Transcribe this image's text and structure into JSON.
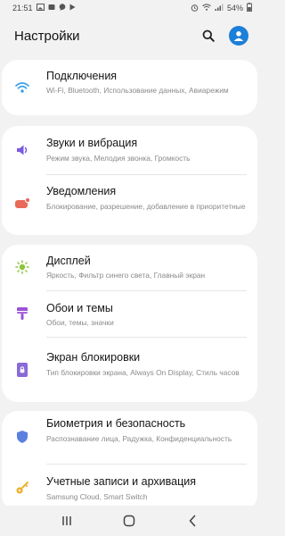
{
  "status_bar": {
    "time": "21:51",
    "battery": "54%",
    "left_icons": [
      "gallery-icon",
      "notification-icon",
      "chat-icon",
      "play-icon"
    ],
    "right_icons": [
      "alarm-icon",
      "wifi-icon",
      "signal-icon",
      "battery-icon"
    ]
  },
  "header": {
    "title": "Настройки",
    "search_icon": "search-icon",
    "profile_icon": "account-icon",
    "accent_color": "#1c7fd8"
  },
  "groups": [
    {
      "items": [
        {
          "title": "Подключения",
          "subtitle": "Wi-Fi, Bluetooth, Использование данных, Авиарежим",
          "icon": "wifi-icon",
          "color": "#3aa0e8"
        }
      ]
    },
    {
      "items": [
        {
          "title": "Звуки и вибрация",
          "subtitle": "Режим звука, Мелодия звонка, Громкость",
          "icon": "volume-icon",
          "color": "#7a5be0"
        },
        {
          "title": "Уведомления",
          "subtitle": "Блокирование, разрешение, добавление в приоритетные",
          "icon": "notification-badge-icon",
          "color": "#e86a5a"
        }
      ]
    },
    {
      "items": [
        {
          "title": "Дисплей",
          "subtitle": "Яркость, Фильтр синего света, Главный экран",
          "icon": "brightness-icon",
          "color": "#8cc43a"
        },
        {
          "title": "Обои и темы",
          "subtitle": "Обои, темы, значки",
          "icon": "brush-icon",
          "color": "#9a52d6"
        },
        {
          "title": "Экран блокировки",
          "subtitle": "Тип блокировки экрана, Always On Display, Стиль часов",
          "icon": "lock-screen-icon",
          "color": "#8a6ad6"
        }
      ]
    },
    {
      "items": [
        {
          "title": "Биометрия и безопасность",
          "subtitle": "Распознавание лица, Радужка, Конфиденциальность",
          "icon": "shield-icon",
          "color": "#5a7fe0"
        },
        {
          "title": "Учетные записи и архивация",
          "subtitle": "Samsung Cloud, Smart Switch",
          "icon": "key-icon",
          "color": "#f0b030"
        }
      ]
    }
  ],
  "nav_bar": {
    "icons": [
      "recent-apps-icon",
      "home-icon",
      "back-icon"
    ]
  }
}
